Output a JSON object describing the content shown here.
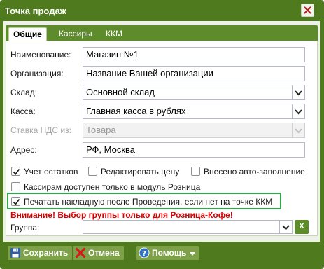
{
  "window": {
    "title": "Точка продаж"
  },
  "tabs": [
    {
      "label": "Общие"
    },
    {
      "label": "Кассиры"
    },
    {
      "label": "ККМ"
    }
  ],
  "form": {
    "name": {
      "label": "Наименование:",
      "value": "Магазин №1"
    },
    "organization": {
      "label": "Организация:",
      "value": "Название Вашей организации"
    },
    "warehouse": {
      "label": "Склад:",
      "value": "Основной склад"
    },
    "cashbox": {
      "label": "Касса:",
      "value": "Главная касса в рублях"
    },
    "vat": {
      "label": "Ставка НДС из:",
      "value": "Товара"
    },
    "address": {
      "label": "Адрес:",
      "value": "РФ, Москва"
    }
  },
  "checkboxes": {
    "stock_accounting": {
      "label": "Учет остатков",
      "checked": true
    },
    "edit_price": {
      "label": "Редактировать цену",
      "checked": false
    },
    "autofill": {
      "label": "Внесено авто-заполнение",
      "checked": false
    },
    "retail_only": {
      "label": "Кассирам доступен только в модуль Розница",
      "checked": false
    },
    "print_invoice": {
      "label": "Печатать накладную после Проведения, если нет на точке ККМ",
      "checked": true
    }
  },
  "warning": "Внимание! Выбор группы только для Розница-Кофе!",
  "group": {
    "label": "Группа:",
    "value": "",
    "clear_label": "X"
  },
  "footer": {
    "save_label": "Сохранить",
    "cancel_label": "Отмена",
    "help_label": "Помощь"
  },
  "colors": {
    "titlebar": "#4f7b1e",
    "tabstrip": "#5e8b2b",
    "highlight": "#2fa84a",
    "warning": "#d90000"
  }
}
